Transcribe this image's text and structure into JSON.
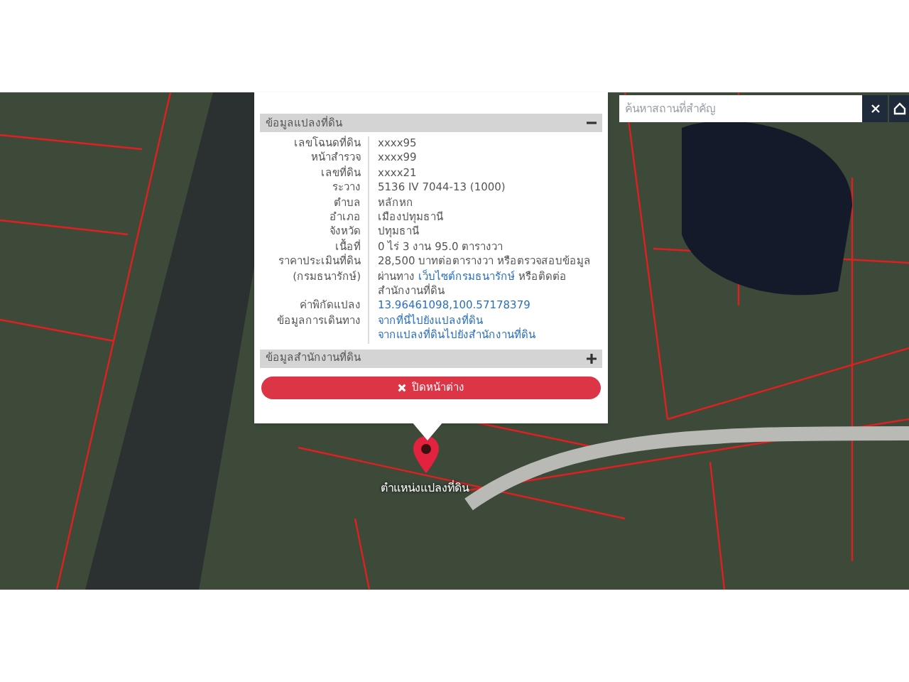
{
  "popup": {
    "sections": [
      {
        "title": "ข้อมูลแปลงที่ดิน",
        "expanded": true,
        "rows": [
          {
            "kind": "text",
            "label": [
              "เลขโฉนดที่ดิน"
            ],
            "value": "xxxx95"
          },
          {
            "kind": "text",
            "label": [
              "หน้าสำรวจ"
            ],
            "value": "xxxx99"
          },
          {
            "kind": "text",
            "label": [
              "เลขที่ดิน"
            ],
            "value": "xxxx21"
          },
          {
            "kind": "text",
            "label": [
              "ระวาง"
            ],
            "value": "5136 IV 7044-13 (1000)"
          },
          {
            "kind": "text",
            "label": [
              "ตำบล"
            ],
            "value": "หลักหก"
          },
          {
            "kind": "text",
            "label": [
              "อำเภอ"
            ],
            "value": "เมืองปทุมธานี"
          },
          {
            "kind": "text",
            "label": [
              "จังหวัด"
            ],
            "value": "ปทุมธานี"
          },
          {
            "kind": "text",
            "label": [
              "เนื้อที่"
            ],
            "value": "0 ไร่ 3 งาน 95.0 ตารางวา"
          },
          {
            "kind": "mixed",
            "label": [
              "ราคาประเมินที่ดิน",
              "(กรมธนารักษ์)"
            ],
            "value_before": "28,500 บาทต่อตารางวา หรือตรวจสอบข้อมูลผ่านทาง",
            "link": "เว็บไซต์กรมธนารักษ์",
            "value_after": "หรือติดต่อสำนักงานที่ดิน"
          },
          {
            "kind": "links",
            "label": [
              "ค่าพิกัดแปลง"
            ],
            "links": [
              "13.96461098,100.57178379"
            ]
          },
          {
            "kind": "links",
            "label": [
              "ข้อมูลการเดินทาง"
            ],
            "links": [
              "จากที่นี่ไปยังแปลงที่ดิน",
              "จากแปลงที่ดินไปยังสำนักงานที่ดิน"
            ]
          }
        ]
      },
      {
        "title": "ข้อมูลสำนักงานที่ดิน",
        "expanded": false
      }
    ],
    "close_button": "ปิดหน้าต่าง"
  },
  "marker": {
    "label": "ตำแหน่งแปลงที่ดิน"
  },
  "search": {
    "placeholder": "ค้นหาสถานที่สำคัญ"
  }
}
